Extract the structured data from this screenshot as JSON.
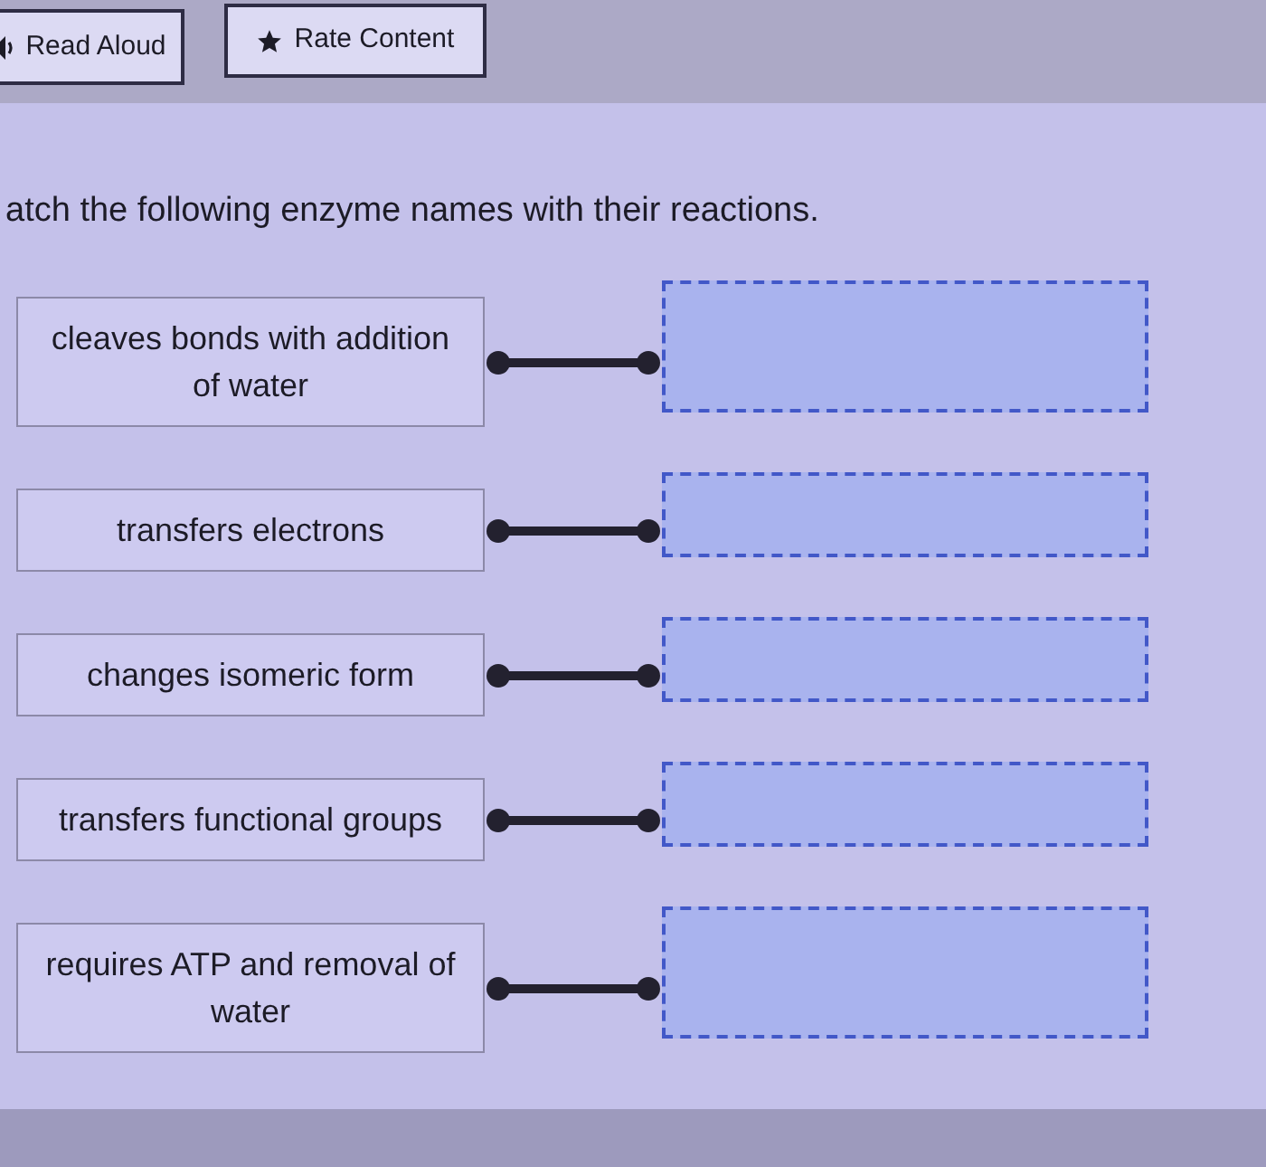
{
  "toolbar": {
    "buttons": [
      {
        "kind": "read_aloud",
        "label": "Read Aloud"
      },
      {
        "kind": "rate",
        "label": "Rate Content"
      }
    ]
  },
  "question": {
    "prompt": "atch the following enzyme names with their reactions."
  },
  "items": [
    {
      "text": "cleaves bonds with addition of water"
    },
    {
      "text": "transfers electrons"
    },
    {
      "text": "changes isomeric form"
    },
    {
      "text": "transfers functional groups"
    },
    {
      "text": "requires ATP and removal of water"
    }
  ]
}
